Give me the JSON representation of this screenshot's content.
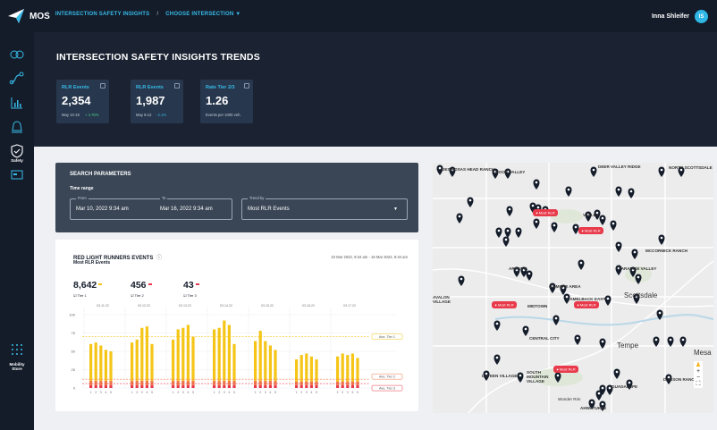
{
  "app": {
    "brand": "MOS"
  },
  "breadcrumbs": [
    "INTERSECTION SAFETY INSIGHTS",
    "CHOOSE INTERSECTION ▼"
  ],
  "user": {
    "name": "Inna Shleifer",
    "initials": "IS"
  },
  "sidebar": {
    "items": [
      "Safety",
      "Mobility Store"
    ]
  },
  "page": {
    "title": "INTERSECTION SAFETY INSIGHTS TRENDS"
  },
  "kpis": [
    {
      "label": "RLR Events",
      "value": "2,354",
      "sub": "May 13-19",
      "change": "+ 4.75%"
    },
    {
      "label": "RLR Events",
      "value": "1,987",
      "sub": "May 6-12",
      "change": "- 2.1%"
    },
    {
      "label": "Rate Tier 2/3",
      "value": "1.26",
      "sub": "Events per 1000 veh.",
      "change": ""
    }
  ],
  "search": {
    "title": "SEARCH PARAMETERS",
    "time_range": "Time range",
    "from_label": "From",
    "from_value": "Mar 10, 2022  9:34 am",
    "to_label": "To",
    "to_value": "Mar 16, 2022  9:34 am",
    "trend_label": "Trend by",
    "trend_value": "Most RLR Events"
  },
  "chart_card": {
    "title": "RED LIGHT RUNNERS EVENTS",
    "subtitle": "Most RLR Events",
    "date_range": "10 Mar 2022, 9:34 am - 16 Mar 2022, 9:34 am",
    "tiers": [
      {
        "value": "8,642",
        "label": "Tier 1",
        "color": "#f5c518"
      },
      {
        "value": "456",
        "label": "Tier 2",
        "color": "#f07a4a"
      },
      {
        "value": "43",
        "label": "Tier 3",
        "color": "#e83a4a"
      }
    ]
  },
  "chart_data": {
    "type": "bar",
    "stacked": true,
    "groups": [
      "03.11.22",
      "03.12.22",
      "03.13.22",
      "03.14.22",
      "03.15.22",
      "03.16.22",
      "03.17.22"
    ],
    "sub_categories": [
      "1",
      "2",
      "3",
      "4",
      "5"
    ],
    "y_ticks": [
      "100",
      "75",
      "50",
      "25",
      "0"
    ],
    "ylim": [
      0,
      100
    ],
    "series": [
      {
        "name": "Tier 1",
        "color": "#f5c518",
        "values": [
          [
            50,
            52,
            48,
            42,
            40
          ],
          [
            52,
            56,
            72,
            74,
            50
          ],
          [
            56,
            70,
            72,
            76,
            60
          ],
          [
            70,
            72,
            82,
            76,
            50
          ],
          [
            54,
            68,
            54,
            48,
            42
          ],
          [
            30,
            36,
            38,
            34,
            30
          ],
          [
            34,
            38,
            36,
            38,
            32
          ]
        ]
      },
      {
        "name": "Tier 2",
        "color": "#f07a4a",
        "values": [
          [
            6,
            6,
            6,
            6,
            6
          ],
          [
            6,
            6,
            6,
            6,
            6
          ],
          [
            6,
            6,
            6,
            6,
            6
          ],
          [
            6,
            6,
            6,
            6,
            6
          ],
          [
            6,
            6,
            6,
            6,
            6
          ],
          [
            5,
            5,
            5,
            5,
            5
          ],
          [
            5,
            5,
            5,
            5,
            5
          ]
        ]
      },
      {
        "name": "Tier 3",
        "color": "#e83a4a",
        "values": [
          [
            4,
            4,
            4,
            4,
            4
          ],
          [
            4,
            4,
            4,
            4,
            4
          ],
          [
            4,
            4,
            4,
            4,
            4
          ],
          [
            4,
            4,
            4,
            4,
            4
          ],
          [
            4,
            4,
            4,
            4,
            4
          ],
          [
            4,
            4,
            4,
            4,
            4
          ],
          [
            4,
            4,
            4,
            4,
            4
          ]
        ]
      }
    ],
    "reference_lines": [
      {
        "label": "Ave. Tier 1",
        "value": 70,
        "color": "#f5c518"
      },
      {
        "label": "Ave. Tier 2",
        "value": 12,
        "color": "#f07a4a"
      },
      {
        "label": "Ave. Tier 3",
        "value": 6,
        "color": "#e83a4a"
      }
    ]
  },
  "map": {
    "badge_label": "Most RLR",
    "labels": [
      "DES ROSAS HEAD RANCH",
      "MOON VALLEY",
      "DEER VALLEY RIDGE",
      "NORTH SCOTTSDALE",
      "VALLEY",
      "MCCORMICK RANCH",
      "PARADISE VALLEY",
      "ARCADIA",
      "MIDTOWN",
      "GILMORE AREA",
      "CAMELBACK EAST",
      "Scottsdale",
      "CENTRAL CITY",
      "Tempe",
      "Mesa",
      "LAVEEN VILLAGE",
      "SOUTH MOUNTAIN VILLAGE",
      "GUADALUPE",
      "DOBSON RANCH",
      "Wonder Rim",
      "AHWATUKEE",
      "AVALON VILLAGE"
    ]
  }
}
